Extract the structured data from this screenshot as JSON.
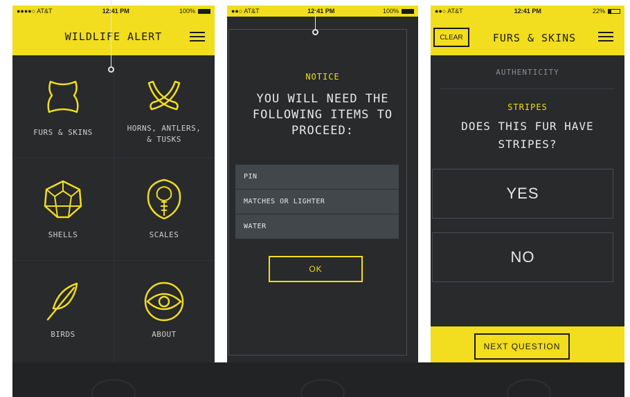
{
  "colors": {
    "accent": "#f2dd1e",
    "background": "#282a2c",
    "item_bg": "#42474c"
  },
  "screens": [
    {
      "status": {
        "carrier": "●●●●○ AT&T",
        "time": "12:41 PM",
        "battery": "100%",
        "battery_level": 1.0
      },
      "header": {
        "title": "WILDLIFE ALERT"
      },
      "categories": [
        {
          "label": "FURS & SKINS",
          "icon": "hide-icon"
        },
        {
          "label": "HORNS, ANTLERS,\n& TUSKS",
          "icon": "horns-icon"
        },
        {
          "label": "SHELLS",
          "icon": "shell-icon"
        },
        {
          "label": "SCALES",
          "icon": "cobra-icon"
        },
        {
          "label": "BIRDS",
          "icon": "feather-icon"
        },
        {
          "label": "ABOUT",
          "icon": "eye-icon"
        }
      ]
    },
    {
      "status": {
        "carrier": "●●○ AT&T",
        "time": "12:41 PM",
        "battery": "100%",
        "battery_level": 1.0
      },
      "notice": {
        "label": "NOTICE",
        "message": "YOU WILL NEED THE FOLLOWING ITEMS TO PROCEED:",
        "items": [
          "PIN",
          "MATCHES OR LIGHTER",
          "WATER"
        ],
        "ok_label": "OK"
      }
    },
    {
      "status": {
        "carrier": "●●○ AT&T",
        "time": "12:41 PM",
        "battery": "22%",
        "battery_level": 0.22
      },
      "header": {
        "clear_label": "CLEAR",
        "title": "FURS & SKINS"
      },
      "section": "AUTHENTICITY",
      "question": {
        "label": "STRIPES",
        "text": "DOES THIS FUR HAVE STRIPES?"
      },
      "answers": [
        "YES",
        "NO"
      ],
      "next_label": "NEXT QUESTION"
    }
  ]
}
